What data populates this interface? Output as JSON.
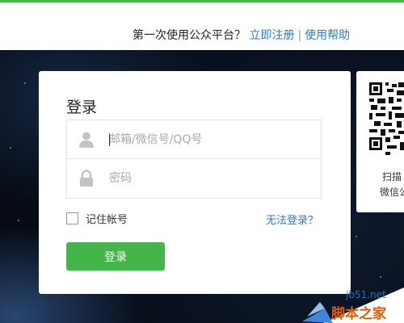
{
  "header": {
    "prompt": "第一次使用公众平台？",
    "register_link": "立即注册",
    "separator": "|",
    "help_link": "使用帮助"
  },
  "login": {
    "title": "登录",
    "username_placeholder": "邮箱/微信号/QQ号",
    "password_placeholder": "密码",
    "remember_label": "记住帐号",
    "forgot_link": "无法登录？",
    "submit_label": "登录"
  },
  "qr": {
    "caption_line1": "扫描",
    "caption_line2": "微信公"
  },
  "watermark": {
    "url": "jb51.net",
    "name": "脚本之家"
  },
  "colors": {
    "accent_green": "#44b549",
    "link_blue": "#2b7bd3"
  }
}
